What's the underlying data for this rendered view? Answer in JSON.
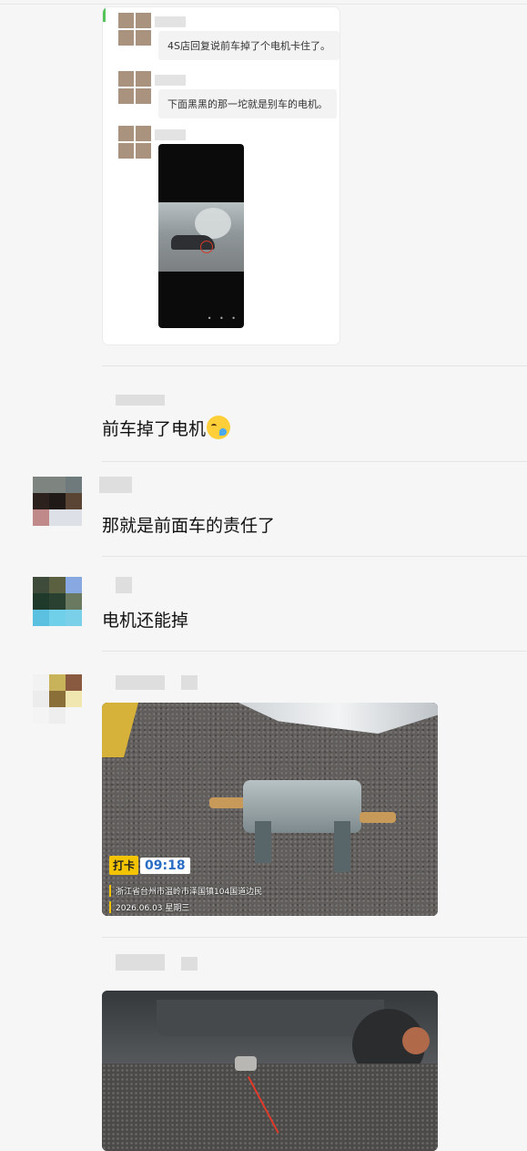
{
  "forwarded_record": {
    "messages": [
      {
        "text": "4S店回复说前车掉了个电机卡住了。"
      },
      {
        "text": "下面黑黑的那一坨就是别车的电机。"
      }
    ],
    "video_controls": "• • •"
  },
  "messages": [
    {
      "text": "前车掉了电机",
      "emoji": "crying-laughing-emoji"
    },
    {
      "text": "那就是前面车的责任了"
    },
    {
      "text": "电机还能掉"
    }
  ],
  "photo1": {
    "checkin_tag": "打卡",
    "time": "09:18",
    "location": "浙江省台州市温岭市泽国镇104国道边民",
    "date": "2026.06.03 星期三"
  },
  "colors": {
    "background": "#f6f6f6",
    "stamp_yellow": "#f5c400",
    "time_blue": "#2a6dc5",
    "accent_green": "#53c35a"
  }
}
